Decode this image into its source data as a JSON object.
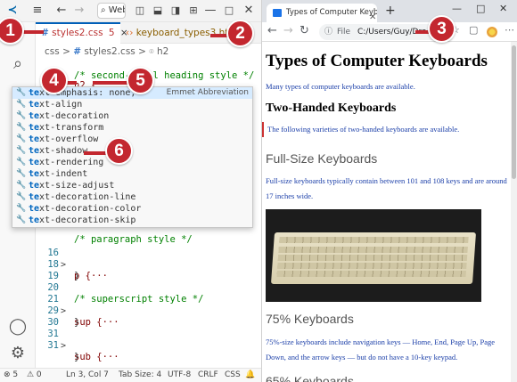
{
  "vscode": {
    "titlebar": {
      "search_text": "Web…"
    },
    "tabs": [
      {
        "filename": "styles2.css",
        "modified_count": "5",
        "close": "×"
      },
      {
        "filename": "keyboard_types3.html"
      }
    ],
    "breadcrumb": {
      "css": "css",
      "sep": ">",
      "file": "styles2.css",
      "selector": "h2"
    },
    "code_lines": [
      {
        "num": "",
        "code": "/* second-level heading style */",
        "kind": "comment"
      },
      {
        "num": "",
        "code": "h2 {",
        "kind": "selector"
      },
      {
        "num": "",
        "code": "  te",
        "kind": "typing"
      },
      {
        "num": "16",
        "fold": ">",
        "code": "p {···",
        "kind": "selector"
      },
      {
        "num": "18",
        "code": "}",
        "kind": "brace"
      },
      {
        "num": "19",
        "code": "",
        "kind": "blank"
      },
      {
        "num": "20",
        "code": "/* superscript style */",
        "kind": "comment"
      },
      {
        "num": "21",
        "fold": ">",
        "code": "sup {···",
        "kind": "selector"
      },
      {
        "num": "29",
        "code": "}",
        "kind": "brace"
      },
      {
        "num": "30",
        "code": "",
        "kind": "blank"
      },
      {
        "num": "31",
        "fold": ">",
        "code": "sub {···",
        "kind": "selector"
      },
      {
        "num": "31",
        "code": "}",
        "kind": "brace"
      },
      {
        "num": "",
        "code": "/* paragraph style */",
        "kind": "comment"
      }
    ],
    "suggestions": [
      {
        "match": "te",
        "rest": "xt-emphasis: none;",
        "detail": "Emmet Abbreviation",
        "active": true
      },
      {
        "match": "te",
        "rest": "xt-align"
      },
      {
        "match": "te",
        "rest": "xt-decoration"
      },
      {
        "match": "te",
        "rest": "xt-transform"
      },
      {
        "match": "te",
        "rest": "xt-overflow"
      },
      {
        "match": "te",
        "rest": "xt-shadow"
      },
      {
        "match": "te",
        "rest": "xt-rendering"
      },
      {
        "match": "te",
        "rest": "xt-indent"
      },
      {
        "match": "te",
        "rest": "xt-size-adjust"
      },
      {
        "match": "te",
        "rest": "xt-decoration-line"
      },
      {
        "match": "te",
        "rest": "xt-decoration-color"
      },
      {
        "match": "te",
        "rest": "xt-decoration-skip"
      }
    ],
    "status": {
      "errors": "⊗ 5",
      "warnings": "⚠ 0",
      "position": "Ln 3, Col 7",
      "tab_size": "Tab Size: 4",
      "encoding": "UTF-8",
      "eol": "CRLF",
      "language": "CSS"
    },
    "icons": [
      "vscode-logo-icon",
      "menu-icon",
      "back-icon",
      "forward-icon",
      "layout-icons",
      "explorer-icon",
      "search-icon",
      "source-control-icon",
      "run-debug-icon",
      "extensions-icon",
      "account-icon",
      "settings-gear-icon"
    ]
  },
  "browser": {
    "tab_title": "Types of Computer Keyboards",
    "address_label": "File",
    "address_url": "C:/Users/Guy/Dro",
    "content": {
      "h1": "Types of Computer Keyboards",
      "p1": "Many types of computer keyboards are available.",
      "h2": "Two-Handed Keyboards",
      "p2": "The following varieties of two-handed keyboards are available.",
      "h3a": "Full-Size Keyboards",
      "p3": "Full-size keyboards typically contain between 101 and 108 keys and are around 17 inches wide.",
      "h3b": "75% Keyboards",
      "p4": "75%-size keyboards include navigation keys — Home, End, Page Up, Page Down, and the arrow keys — but do not have a 10-key keypad.",
      "h3c": "65% Keyboards"
    }
  },
  "callouts": [
    "1",
    "2",
    "3",
    "4",
    "5",
    "6"
  ],
  "colors": {
    "callout": "#c3272f",
    "vscode_blue": "#005fb8",
    "link_blue": "#1a3ea8"
  }
}
